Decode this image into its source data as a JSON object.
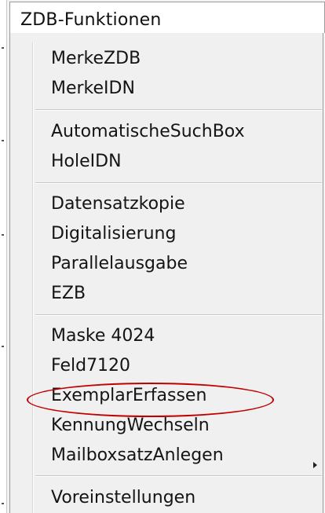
{
  "menu": {
    "title": "ZDB-Funktionen",
    "groups": [
      [
        "MerkeZDB",
        "MerkeIDN"
      ],
      [
        "AutomatischeSuchBox",
        "HoleIDN"
      ],
      [
        "Datensatzkopie",
        "Digitalisierung",
        "Parallelausgabe",
        "EZB"
      ],
      [
        "Maske 4024",
        "Feld7120",
        "ExemplarErfassen",
        "KennungWechseln",
        "MailboxsatzAnlegen"
      ],
      [
        "Voreinstellungen"
      ]
    ],
    "highlighted_item": "ExemplarErfassen",
    "highlight_color": "#c00000"
  },
  "items": {
    "merke_zdb": "MerkeZDB",
    "merke_idn": "MerkeIDN",
    "auto_such_box": "AutomatischeSuchBox",
    "hole_idn": "HoleIDN",
    "datensatzkopie": "Datensatzkopie",
    "digitalisierung": "Digitalisierung",
    "parallelausgabe": "Parallelausgabe",
    "ezb": "EZB",
    "maske_4024": "Maske 4024",
    "feld7120": "Feld7120",
    "exemplar_erfassen": "ExemplarErfassen",
    "kennung_wechseln": "KennungWechseln",
    "mailboxsatz_anlegen": "MailboxsatzAnlegen",
    "voreinstellungen": "Voreinstellungen"
  },
  "icons": {
    "submenu": "chevron-right-icon"
  }
}
